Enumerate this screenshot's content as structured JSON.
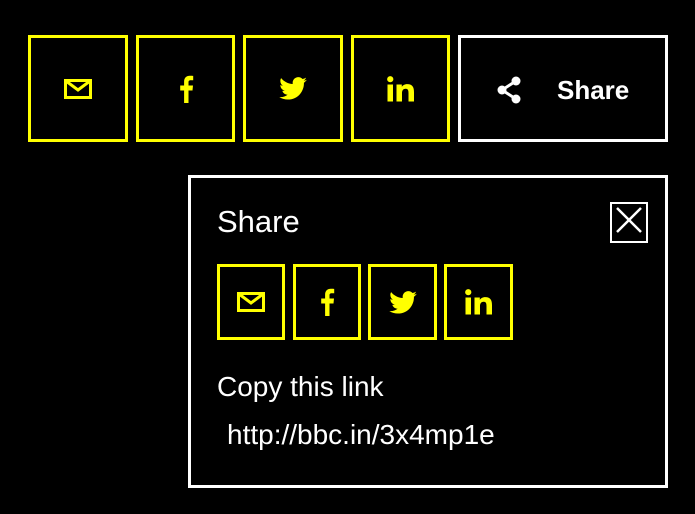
{
  "colors": {
    "accent": "#ffff00",
    "background": "#000000",
    "foreground": "#ffffff"
  },
  "toolbar": {
    "buttons": [
      {
        "icon": "email-icon"
      },
      {
        "icon": "facebook-icon"
      },
      {
        "icon": "twitter-icon"
      },
      {
        "icon": "linkedin-icon"
      }
    ],
    "share_label": "Share",
    "share_icon": "share-icon"
  },
  "popup": {
    "title": "Share",
    "close_icon": "close-icon",
    "buttons": [
      {
        "icon": "email-icon"
      },
      {
        "icon": "facebook-icon"
      },
      {
        "icon": "twitter-icon"
      },
      {
        "icon": "linkedin-icon"
      }
    ],
    "copy_label": "Copy this link",
    "link": "http://bbc.in/3x4mp1e"
  }
}
